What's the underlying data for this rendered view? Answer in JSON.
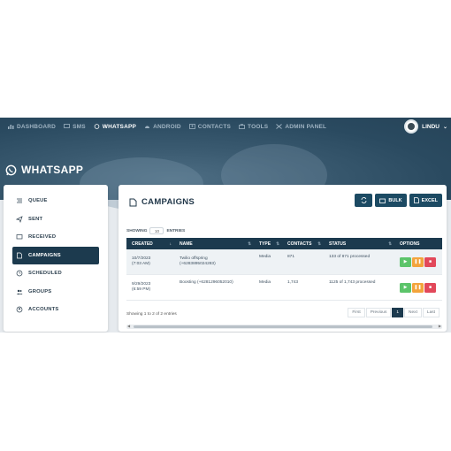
{
  "nav": {
    "items": [
      {
        "label": "DASHBOARD",
        "icon": "bar-chart-icon"
      },
      {
        "label": "SMS",
        "icon": "message-icon"
      },
      {
        "label": "WHATSAPP",
        "icon": "whatsapp-icon"
      },
      {
        "label": "ANDROID",
        "icon": "android-icon"
      },
      {
        "label": "CONTACTS",
        "icon": "contacts-icon"
      },
      {
        "label": "TOOLS",
        "icon": "toolbox-icon"
      },
      {
        "label": "ADMIN PANEL",
        "icon": "admin-icon"
      }
    ],
    "active": "WHATSAPP",
    "user": "LINDU"
  },
  "page": {
    "title": "WHATSAPP"
  },
  "sidebar": {
    "items": [
      {
        "label": "QUEUE",
        "icon": "queue-list-icon"
      },
      {
        "label": "SENT",
        "icon": "paper-plane-icon"
      },
      {
        "label": "RECEIVED",
        "icon": "inbox-message-icon"
      },
      {
        "label": "CAMPAIGNS",
        "icon": "campaign-icon"
      },
      {
        "label": "SCHEDULED",
        "icon": "clock-icon"
      },
      {
        "label": "GROUPS",
        "icon": "groups-icon"
      },
      {
        "label": "ACCOUNTS",
        "icon": "account-icon"
      }
    ],
    "active": "CAMPAIGNS"
  },
  "panel": {
    "title": "CAMPAIGNS",
    "buttons": {
      "refresh": "refresh-icon",
      "bulk": "BULK",
      "excel": "EXCEL"
    },
    "showing_label": "SHOWING",
    "entries_value": "10",
    "entries_label": "ENTRIES",
    "columns": [
      "CREATED",
      "NAME",
      "TYPE",
      "CONTACTS",
      "STATUS",
      "OPTIONS"
    ],
    "rows": [
      {
        "created_date": "10/7/2023",
        "created_time": "(7:03 AM)",
        "name_line1": "Twilio offspring",
        "name_line2": "(+6283895024283)",
        "type": "Media",
        "contacts": "871",
        "status": "133 of 871 processed"
      },
      {
        "created_date": "9/29/2023",
        "created_time": "(6:59 PM)",
        "name_line1": "Boosting (+6281296052010)",
        "name_line2": "",
        "type": "Media",
        "contacts": "1,743",
        "status": "1125 of 1,743 processed"
      }
    ],
    "footer": "Showing 1 to 2 of 2 entries",
    "pager": {
      "first": "First",
      "previous": "Previous",
      "current": "1",
      "next": "Next",
      "last": "Last"
    }
  },
  "colors": {
    "nav_bg": "#2a4a60",
    "primary": "#1c3a4e",
    "play": "#5cc46a",
    "pause": "#f3a43c",
    "delete": "#e2485a"
  }
}
